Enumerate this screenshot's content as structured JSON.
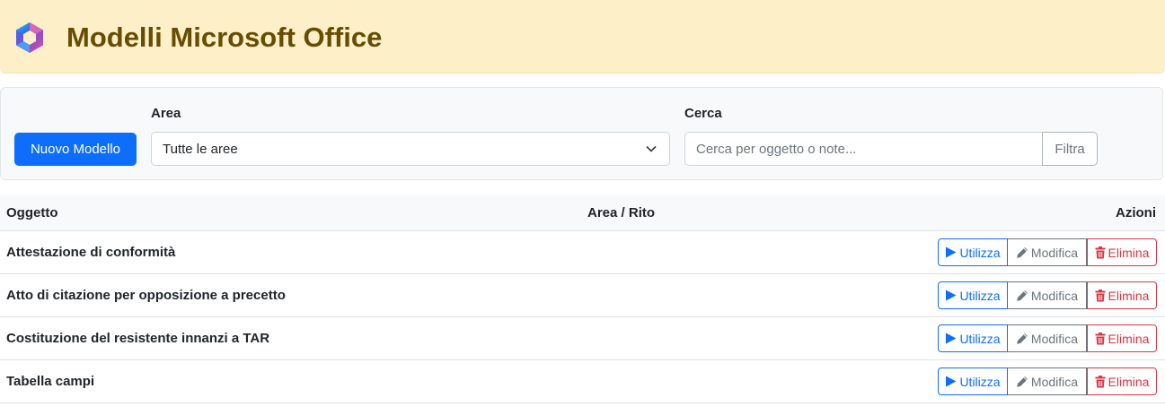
{
  "header": {
    "title": "Modelli Microsoft Office",
    "logo_icon": "microsoft-office-logo-icon",
    "background_color": "#fdf0c8",
    "title_color": "#664d03"
  },
  "filters": {
    "new_button_label": "Nuovo Modello",
    "area_label": "Area",
    "area_selected": "Tutte le aree",
    "search_label": "Cerca",
    "search_placeholder": "Cerca per oggetto o note...",
    "search_value": "",
    "filter_button_label": "Filtra"
  },
  "table": {
    "columns": [
      "Oggetto",
      "Area / Rito",
      "Azioni"
    ],
    "rows": [
      {
        "oggetto": "Attestazione di conformità",
        "area": ""
      },
      {
        "oggetto": "Atto di citazione per opposizione a precetto",
        "area": ""
      },
      {
        "oggetto": "Costituzione del resistente innanzi a TAR",
        "area": ""
      },
      {
        "oggetto": "Tabella campi",
        "area": ""
      }
    ],
    "actions": {
      "use_label": "Utilizza",
      "use_icon": "play-icon",
      "edit_label": "Modifica",
      "edit_icon": "pencil-icon",
      "delete_label": "Elimina",
      "delete_icon": "trash-icon"
    }
  },
  "colors": {
    "primary": "#0d6efd",
    "secondary": "#6c757d",
    "danger": "#dc3545"
  }
}
